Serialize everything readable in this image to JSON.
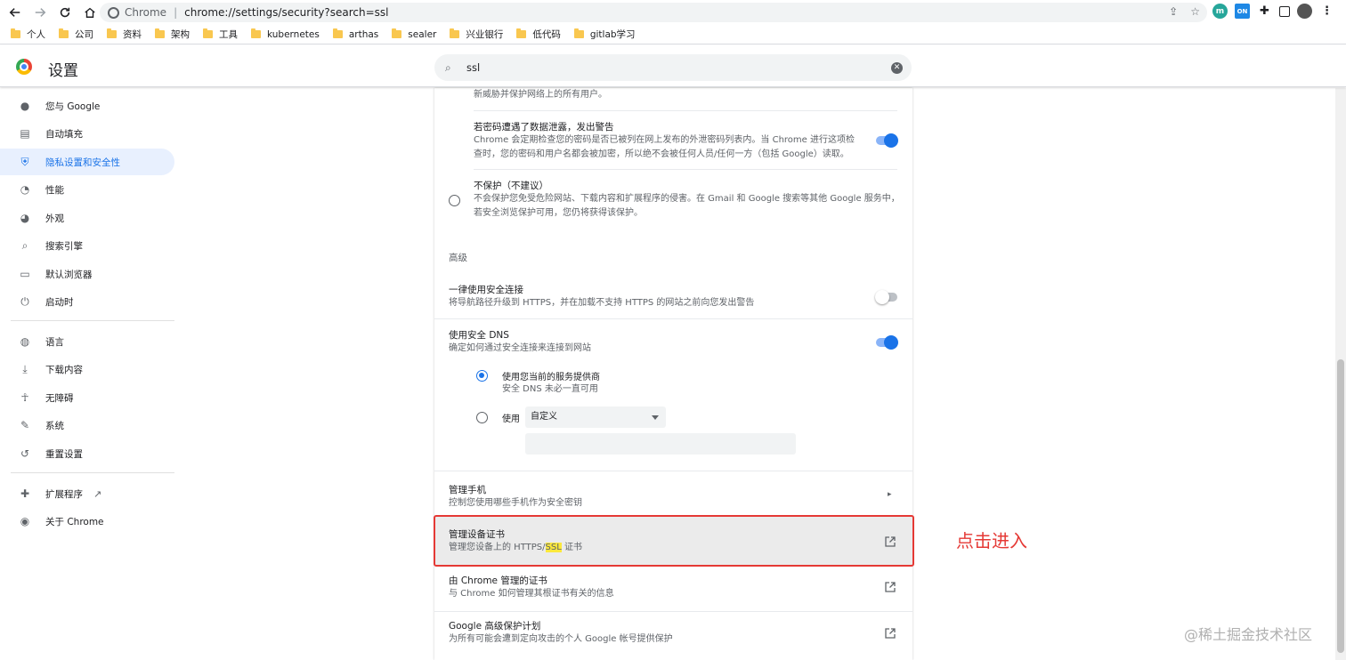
{
  "browser": {
    "site_name": "Chrome",
    "url": "chrome://settings/security?search=ssl",
    "bookmarks": [
      "个人",
      "公司",
      "资料",
      "架构",
      "工具",
      "kubernetes",
      "arthas",
      "sealer",
      "兴业银行",
      "低代码",
      "gitlab学习"
    ],
    "extension_badge": "ON"
  },
  "header": {
    "title": "设置",
    "search_value": "ssl"
  },
  "sidebar": {
    "items": [
      {
        "label": "您与 Google",
        "icon": "person-icon"
      },
      {
        "label": "自动填充",
        "icon": "clipboard-icon"
      },
      {
        "label": "隐私设置和安全性",
        "icon": "shield-icon",
        "active": true
      },
      {
        "label": "性能",
        "icon": "speedometer-icon"
      },
      {
        "label": "外观",
        "icon": "palette-icon"
      },
      {
        "label": "搜索引擎",
        "icon": "search-icon"
      },
      {
        "label": "默认浏览器",
        "icon": "browser-icon"
      },
      {
        "label": "启动时",
        "icon": "power-icon"
      },
      {
        "label": "语言",
        "icon": "globe-icon"
      },
      {
        "label": "下载内容",
        "icon": "download-icon"
      },
      {
        "label": "无障碍",
        "icon": "accessibility-icon"
      },
      {
        "label": "系统",
        "icon": "wrench-icon"
      },
      {
        "label": "重置设置",
        "icon": "reset-icon"
      },
      {
        "label": "扩展程序",
        "icon": "puzzle-icon"
      },
      {
        "label": "关于 Chrome",
        "icon": "chrome-icon"
      }
    ]
  },
  "main": {
    "partial_top_sub": "新威胁并保护网络上的所有用户。",
    "password_warn": {
      "title": "若密码遭遇了数据泄露，发出警告",
      "sub1": "Chrome 会定期检查您的密码是否已被列在网上发布的外泄密码列表内。当 Chrome 进行这项检",
      "sub2": "查时，您的密码和用户名都会被加密，所以绝不会被任何人员/任何一方（包括 Google）读取。",
      "enabled": true
    },
    "no_protection": {
      "title": "不保护（不建议）",
      "sub1": "不会保护您免受危险网站、下载内容和扩展程序的侵害。在 Gmail 和 Google 搜索等其他 Google 服务中，",
      "sub2": "若安全浏览保护可用，您仍将获得该保护。"
    },
    "advanced_label": "高级",
    "https_only": {
      "title": "一律使用安全连接",
      "sub": "将导航路径升级到 HTTPS，并在加载不支持 HTTPS 的网站之前向您发出警告",
      "enabled": false
    },
    "secure_dns": {
      "title": "使用安全 DNS",
      "sub": "确定如何通过安全连接来连接到网站",
      "enabled": true,
      "option_current": "使用您当前的服务提供商",
      "option_current_sub": "安全 DNS 未必一直可用",
      "option_custom": "使用",
      "custom_select": "自定义"
    },
    "manage_phones": {
      "title": "管理手机",
      "sub": "控制您使用哪些手机作为安全密钥"
    },
    "manage_certs": {
      "title": "管理设备证书",
      "sub_before": "管理您设备上的 HTTPS/",
      "sub_highlight": "SSL",
      "sub_after": " 证书"
    },
    "chrome_certs": {
      "title": "由 Chrome 管理的证书",
      "sub": "与 Chrome 如何管理其根证书有关的信息"
    },
    "advanced_protection": {
      "title": "Google 高级保护计划",
      "sub": "为所有可能会遭到定向攻击的个人 Google 帐号提供保护"
    }
  },
  "annotation": {
    "text": "点击进入",
    "color": "#e53935"
  },
  "watermark": "@稀土掘金技术社区",
  "colors": {
    "accent": "#1a73e8",
    "active_bg": "#e8f0fe"
  }
}
